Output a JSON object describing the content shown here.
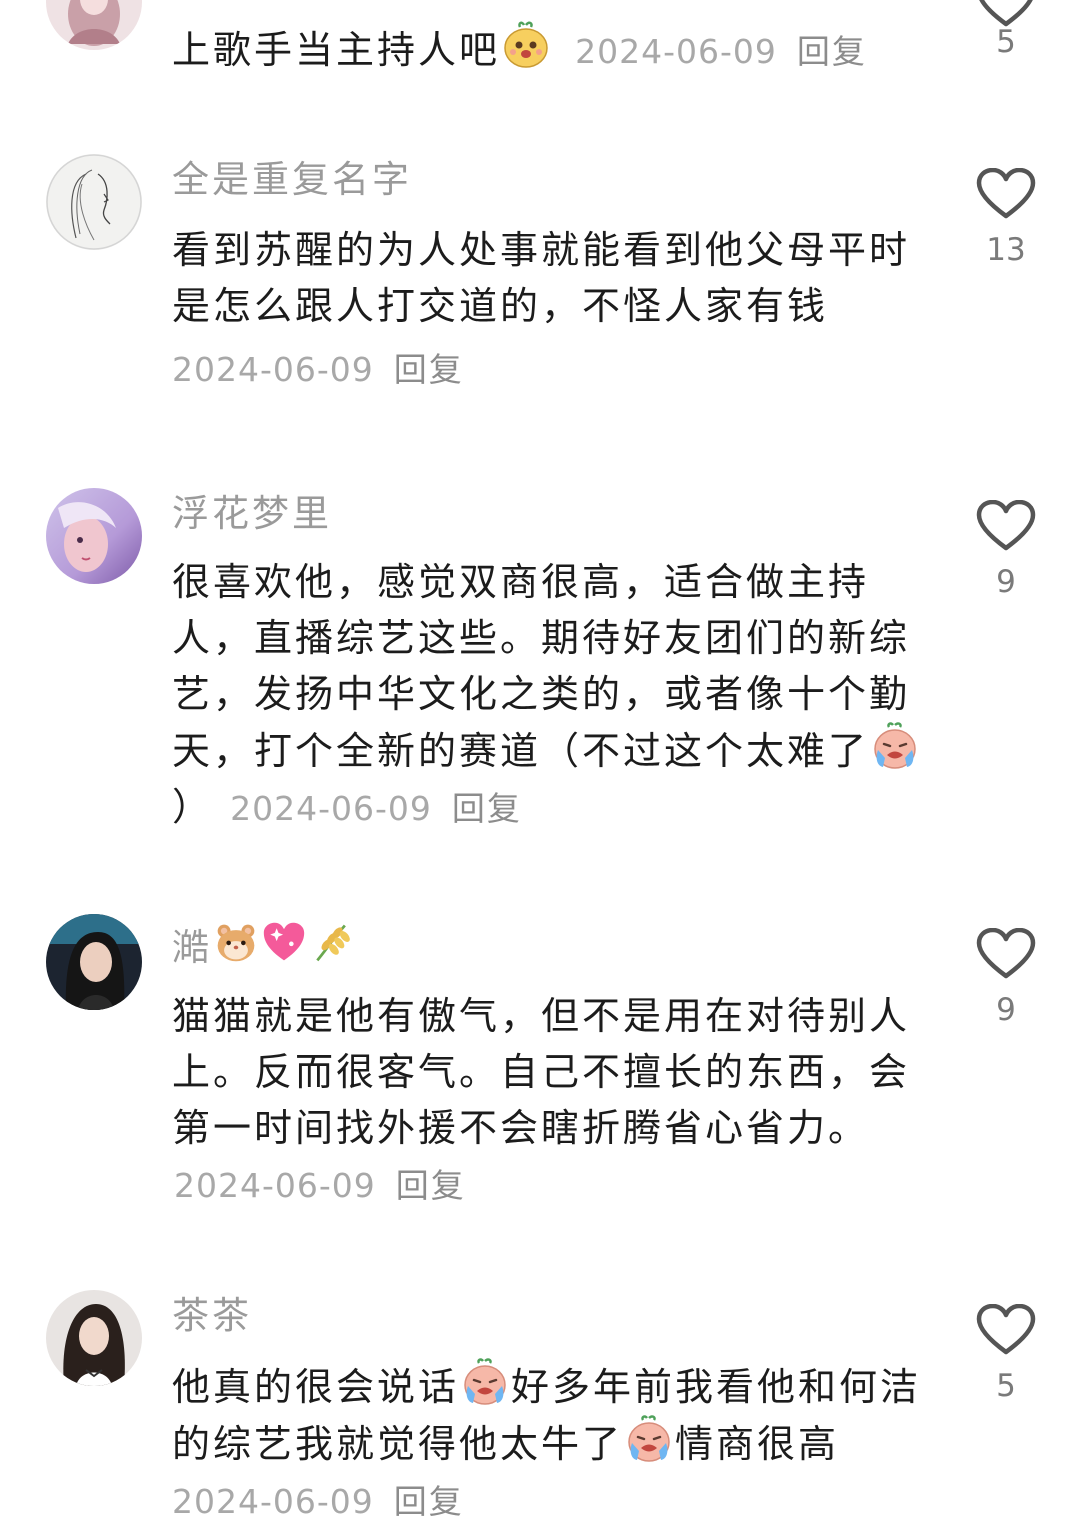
{
  "comments": [
    {
      "body": "上歌手当主持人吧",
      "timestamp": "2024-06-09",
      "reply_label": "回复",
      "likes": "5",
      "emoji": "cat-emoji"
    },
    {
      "username": "全是重复名字",
      "body": "看到苏醒的为人处事就能看到他父母平时是怎么跟人打交道的，不怪人家有钱",
      "timestamp": "2024-06-09",
      "reply_label": "回复",
      "likes": "13"
    },
    {
      "username": "浮花梦里",
      "body": "很喜欢他，感觉双商很高，适合做主持人，直播综艺这些。期待好友团们的新综艺，发扬中华文化之类的，或者像十个勤天，打个全新的赛道（不过这个太难了",
      "body_end": "）",
      "timestamp": "2024-06-09",
      "reply_label": "回复",
      "likes": "9",
      "emoji": "crying-face-emoji"
    },
    {
      "username": "澔",
      "username_emojis": [
        "hamster-emoji",
        "sparkling-heart-emoji",
        "rice-ear-emoji"
      ],
      "body": "猫猫就是他有傲气，但不是用在对待别人上。反而很客气。自己不擅长的东西，会第一时间找外援不会瞎折腾省心省力。",
      "timestamp": "2024-06-09",
      "reply_label": "回复",
      "likes": "9"
    },
    {
      "username": "茶茶",
      "body_a": "他真的很会说话",
      "body_b": "好多年前我看他和何洁的综艺我就觉得他太牛了",
      "body_c": "情商很高",
      "timestamp": "2024-06-09",
      "reply_label": "回复",
      "likes": "5",
      "emojis": [
        "crying-face-emoji",
        "crying-face-emoji"
      ]
    }
  ],
  "colors": {
    "username": "#9a9a9a",
    "body_text": "#1c1c1c",
    "meta": "#a8a8a8",
    "heart_outline": "#555555"
  }
}
